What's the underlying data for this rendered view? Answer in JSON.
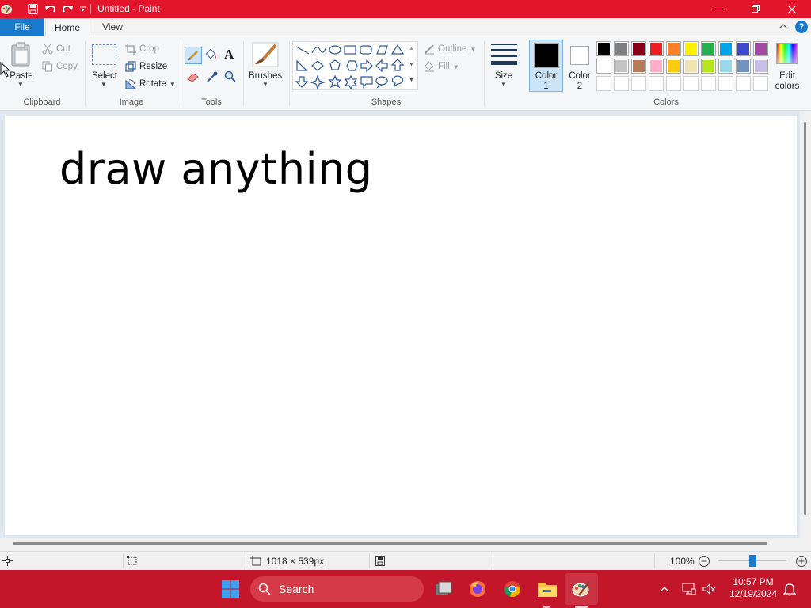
{
  "window": {
    "title": "Untitled - Paint",
    "accent_color": "#e3152a"
  },
  "tabs": [
    {
      "label": "File"
    },
    {
      "label": "Home"
    },
    {
      "label": "View"
    }
  ],
  "ribbon": {
    "clipboard": {
      "paste_label": "Paste",
      "cut_label": "Cut",
      "copy_label": "Copy",
      "group_label": "Clipboard"
    },
    "image": {
      "select_label": "Select",
      "crop_label": "Crop",
      "resize_label": "Resize",
      "rotate_label": "Rotate",
      "group_label": "Image"
    },
    "tools": {
      "group_label": "Tools"
    },
    "brushes": {
      "label": "Brushes"
    },
    "shapes": {
      "outline_label": "Outline",
      "fill_label": "Fill",
      "group_label": "Shapes"
    },
    "size": {
      "label": "Size"
    },
    "colors": {
      "color1_label_line1": "Color",
      "color1_label_line2": "1",
      "color2_label_line1": "Color",
      "color2_label_line2": "2",
      "edit_label_line1": "Edit",
      "edit_label_line2": "colors",
      "group_label": "Colors",
      "color1": "#000000",
      "color2": "#ffffff",
      "palette": [
        [
          "#000000",
          "#7f7f7f",
          "#880015",
          "#ed1c24",
          "#ff7f27",
          "#fff200",
          "#22b14c",
          "#00a2e8",
          "#3f48cc",
          "#a349a4"
        ],
        [
          "#ffffff",
          "#c3c3c3",
          "#b97a57",
          "#ffaec9",
          "#ffc90e",
          "#efe4b0",
          "#b5e61d",
          "#99d9ea",
          "#7092be",
          "#c8bfe7"
        ],
        [
          "#ffffff",
          "#ffffff",
          "#ffffff",
          "#ffffff",
          "#ffffff",
          "#ffffff",
          "#ffffff",
          "#ffffff",
          "#ffffff",
          "#ffffff"
        ]
      ]
    }
  },
  "canvas": {
    "text": "draw anything"
  },
  "status": {
    "dimensions": "1018 × 539px",
    "zoom": "100%",
    "zoom_slider_percent": 50
  },
  "taskbar": {
    "search_label": "Search",
    "time": "10:57 PM",
    "date": "12/19/2024"
  }
}
